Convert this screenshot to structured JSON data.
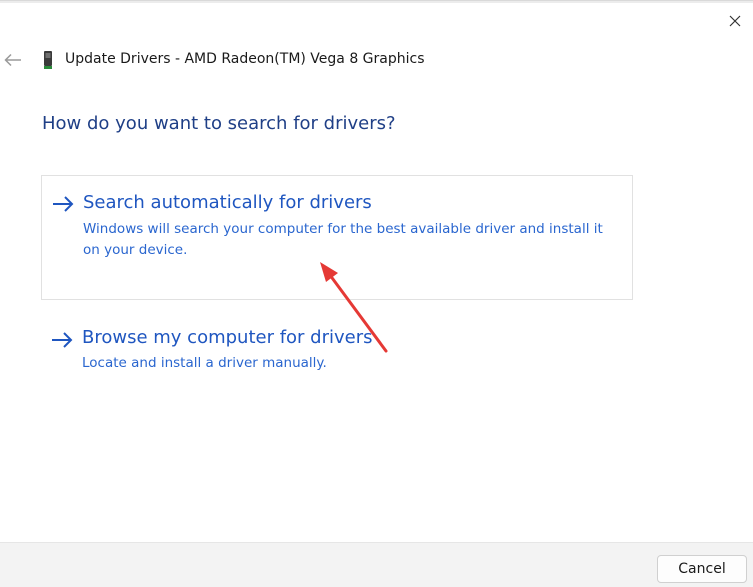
{
  "header": {
    "title": "Update Drivers - AMD Radeon(TM) Vega 8 Graphics",
    "back_icon": "back-arrow-icon",
    "device_icon": "display-adapter-icon"
  },
  "question": "How do you want to search for drivers?",
  "options": [
    {
      "title": "Search automatically for drivers",
      "description": "Windows will search your computer for the best available driver and install it on your device.",
      "icon": "right-arrow-icon"
    },
    {
      "title": "Browse my computer for drivers",
      "description": "Locate and install a driver manually.",
      "icon": "right-arrow-icon"
    }
  ],
  "footer": {
    "cancel_label": "Cancel"
  },
  "colors": {
    "heading": "#1f3f86",
    "link": "#1f56c0",
    "annotation_arrow": "#e53935"
  }
}
